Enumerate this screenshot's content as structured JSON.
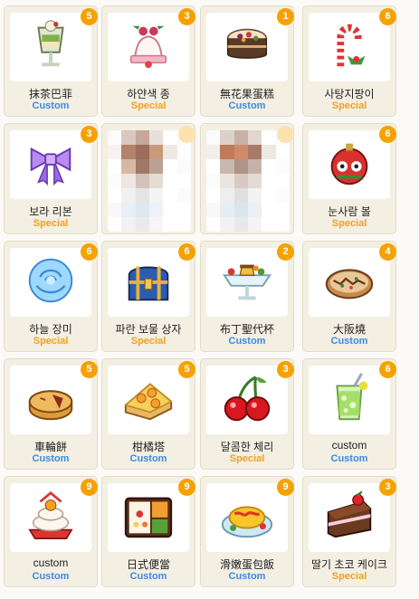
{
  "items": [
    {
      "name": "抹茶巴菲",
      "tag": "Custom",
      "count": "5",
      "icon": "matcha-parfait-icon"
    },
    {
      "name": "하얀색 종",
      "tag": "Special",
      "count": "3",
      "icon": "white-bell-icon"
    },
    {
      "name": "無花果蛋糕",
      "tag": "Custom",
      "count": "1",
      "icon": "fig-cake-icon"
    },
    {
      "name": "사탕지팡이",
      "tag": "Special",
      "count": "6",
      "icon": "candy-cane-icon"
    },
    {
      "name": "보라 리본",
      "tag": "Special",
      "count": "3",
      "icon": "purple-ribbon-icon"
    },
    {
      "name": "",
      "tag": "",
      "count": "",
      "icon": "blurred-item-icon"
    },
    {
      "name": "",
      "tag": "",
      "count": "",
      "icon": "blurred-item-icon"
    },
    {
      "name": "눈사람 볼",
      "tag": "Special",
      "count": "6",
      "icon": "snowman-ornament-icon"
    },
    {
      "name": "하늘 장미",
      "tag": "Special",
      "count": "6",
      "icon": "sky-rose-icon"
    },
    {
      "name": "파란 보물 상자",
      "tag": "Special",
      "count": "6",
      "icon": "blue-treasure-chest-icon"
    },
    {
      "name": "布丁聖代杯",
      "tag": "Custom",
      "count": "2",
      "icon": "pudding-sundae-icon"
    },
    {
      "name": "大阪燒",
      "tag": "Custom",
      "count": "4",
      "icon": "okonomiyaki-icon"
    },
    {
      "name": "車輪餅",
      "tag": "Custom",
      "count": "5",
      "icon": "wheel-cake-icon"
    },
    {
      "name": "柑橘塔",
      "tag": "Custom",
      "count": "5",
      "icon": "citrus-tart-icon"
    },
    {
      "name": "달콤한 체리",
      "tag": "Special",
      "count": "3",
      "icon": "cherry-icon"
    },
    {
      "name": "custom",
      "tag": "Custom",
      "count": "6",
      "icon": "green-drink-icon"
    },
    {
      "name": "custom",
      "tag": "Custom",
      "count": "9",
      "icon": "kagami-mochi-icon"
    },
    {
      "name": "日式便當",
      "tag": "Custom",
      "count": "9",
      "icon": "bento-icon"
    },
    {
      "name": "滑嫩蛋包飯",
      "tag": "Custom",
      "count": "9",
      "icon": "omurice-icon"
    },
    {
      "name": "딸기 초코 케이크",
      "tag": "Special",
      "count": "3",
      "icon": "strawberry-choco-cake-icon"
    }
  ],
  "colors": {
    "custom": "#3d8be0",
    "special": "#f0a020",
    "badge": "#f5a200"
  }
}
